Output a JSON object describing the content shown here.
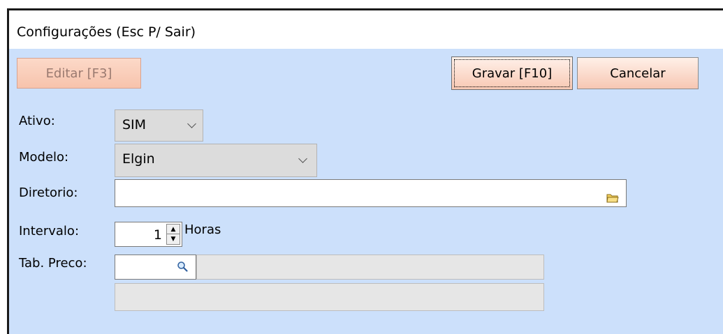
{
  "window": {
    "title": "Configurações (Esc P/ Sair)"
  },
  "toolbar": {
    "editar_label": "Editar [F3]",
    "gravar_label": "Gravar [F10]",
    "cancelar_label": "Cancelar"
  },
  "form": {
    "ativo": {
      "label": "Ativo:",
      "value": "SIM"
    },
    "modelo": {
      "label": "Modelo:",
      "value": "Elgin"
    },
    "diretorio": {
      "label": "Diretorio:",
      "value": ""
    },
    "intervalo": {
      "label": "Intervalo:",
      "value": "1",
      "unit": "Horas"
    },
    "tab_preco": {
      "label": "Tab. Preco:",
      "value": ""
    }
  },
  "icons": {
    "folder": "folder-icon",
    "lookup": "magnifier-icon",
    "chevron": "chevron-down-icon"
  },
  "colors": {
    "window_bg": "#cce0fb",
    "button_accent": "#f7c7b3"
  }
}
